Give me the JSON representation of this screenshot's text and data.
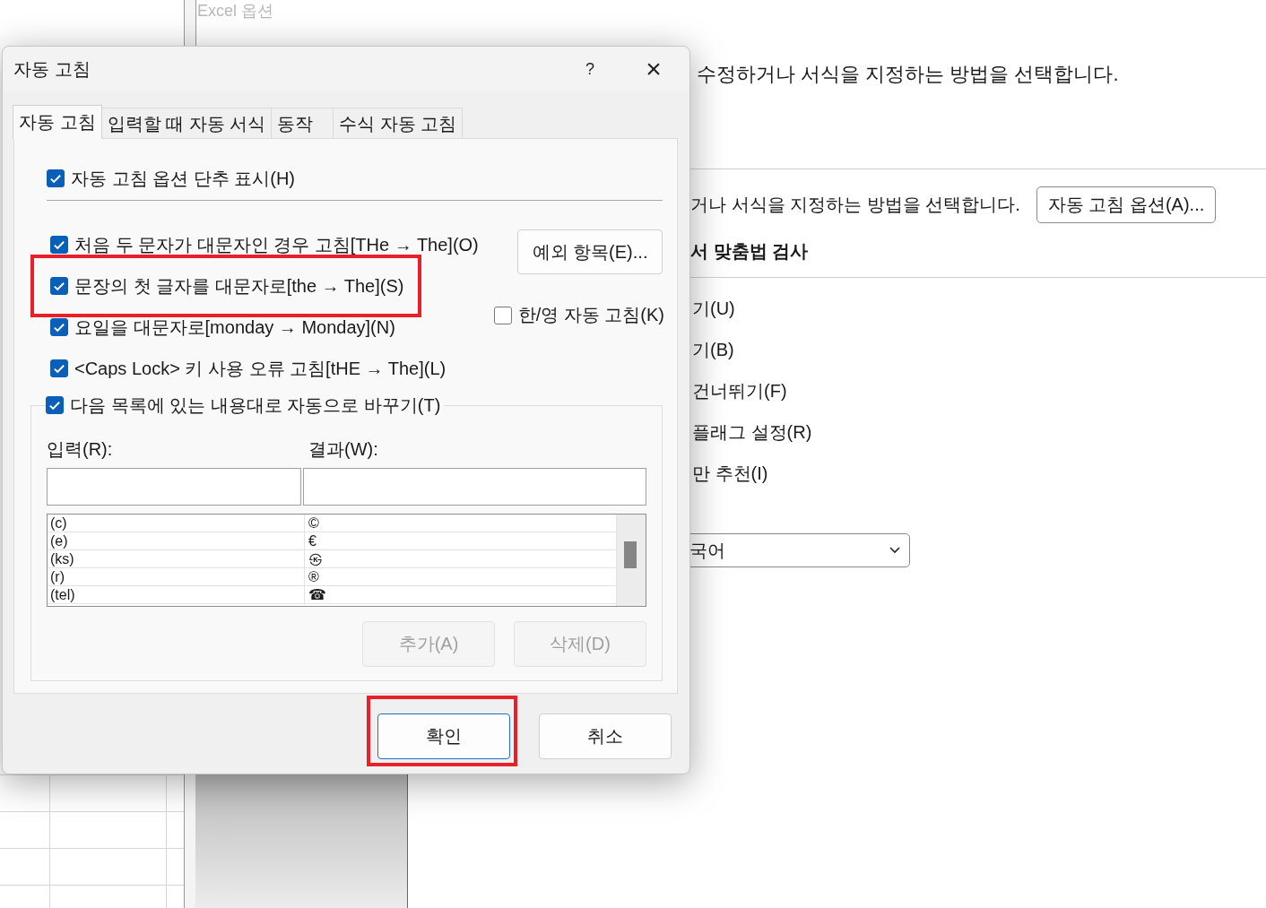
{
  "background_window": {
    "title": "Excel 옵션",
    "intro": "수정하거나 서식을 지정하는 방법을 선택합니다.",
    "autocorrect_row": {
      "text": "거나 서식을 지정하는 방법을 선택합니다.",
      "button": "자동 고침 옵션(A)..."
    },
    "section_title": "서 맞춤법 검사",
    "items": [
      "기(U)",
      "기(B)",
      "건너뛰기(F)",
      "플래그 설정(R)",
      "만 추천(I)"
    ],
    "language_select": {
      "value": "국어"
    }
  },
  "dialog": {
    "title": "자동 고침",
    "help": "?",
    "close": "×",
    "tabs": [
      {
        "label": "자동 고침",
        "selected": true
      },
      {
        "label": "입력할 때 자동 서식",
        "selected": false
      },
      {
        "label": "동작",
        "selected": false
      },
      {
        "label": "수식 자동 고침",
        "selected": false
      }
    ],
    "show_buttons_option": {
      "label": "자동 고침 옵션 단추 표시(H)",
      "checked": true
    },
    "options": [
      {
        "label": "처음 두 문자가 대문자인 경우 고침[THe → The](O)",
        "checked": true,
        "highlighted": false
      },
      {
        "label": "문장의 첫 글자를 대문자로[the → The](S)",
        "checked": true,
        "highlighted": true
      },
      {
        "label": "요일을 대문자로[monday → Monday](N)",
        "checked": true,
        "highlighted": false
      },
      {
        "label": "<Caps Lock> 키 사용 오류 고침[tHE → The](L)",
        "checked": true,
        "highlighted": false
      }
    ],
    "exceptions_button": "예외 항목(E)...",
    "korean_english_option": {
      "label": "한/영 자동 고침(K)",
      "checked": false
    },
    "replace_group": {
      "label": "다음 목록에 있는 내용대로 자동으로 바꾸기(T)",
      "checked": true,
      "input_label": "입력(R):",
      "result_label": "결과(W):",
      "rows": [
        {
          "input": "(c)",
          "result": "©"
        },
        {
          "input": "(e)",
          "result": "€"
        },
        {
          "input": "(ks)",
          "result": "㉿"
        },
        {
          "input": "(r)",
          "result": "®"
        },
        {
          "input": "(tel)",
          "result": "☎"
        }
      ],
      "buttons": [
        {
          "label": "추가(A)",
          "disabled": true
        },
        {
          "label": "삭제(D)",
          "disabled": true
        }
      ]
    },
    "footer_buttons": [
      {
        "label": "확인",
        "default": true,
        "highlighted": true
      },
      {
        "label": "취소",
        "default": false,
        "highlighted": false
      }
    ]
  }
}
